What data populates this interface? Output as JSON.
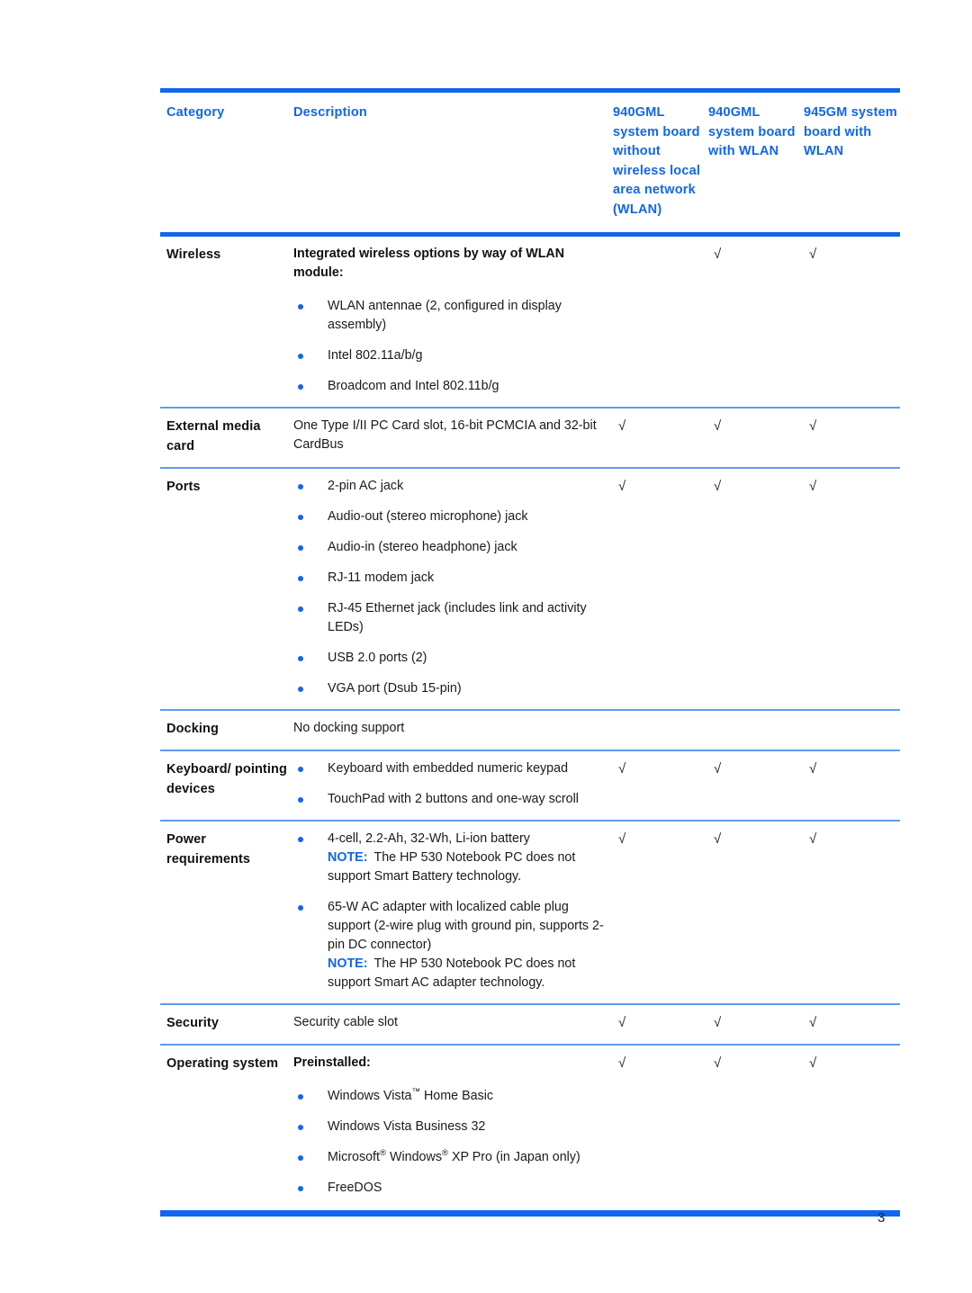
{
  "document": {
    "page_number": "3",
    "accent_color": "#1066EE",
    "rule_color": "#5E9BF0"
  },
  "table": {
    "headers": {
      "category": "Category",
      "description": "Description",
      "col1": "940GML system board without wireless local area network (WLAN)",
      "col2": "940GML system board with WLAN",
      "col3": "945GM system board with WLAN"
    },
    "check_glyph": "√",
    "rows": [
      {
        "category": "Wireless",
        "lead": "Integrated wireless options by way of WLAN module:",
        "bullets": [
          "WLAN antennae (2, configured in display assembly)",
          "Intel 802.11a/b/g",
          "Broadcom and Intel 802.11b/g"
        ],
        "checks": [
          "",
          "√",
          "√"
        ]
      },
      {
        "category": "External media card",
        "text": "One Type I/II PC Card slot, 16-bit PCMCIA and 32-bit CardBus",
        "checks": [
          "√",
          "√",
          "√"
        ]
      },
      {
        "category": "Ports",
        "bullets": [
          "2-pin AC jack",
          "Audio-out (stereo microphone) jack",
          "Audio-in (stereo headphone) jack",
          "RJ-11 modem jack",
          "RJ-45 Ethernet jack (includes link and activity LEDs)",
          "USB 2.0 ports (2)",
          "VGA port (Dsub 15-pin)"
        ],
        "checks": [
          "√",
          "√",
          "√"
        ]
      },
      {
        "category": "Docking",
        "text": "No docking support",
        "checks": [
          "",
          "",
          ""
        ]
      },
      {
        "category": "Keyboard/ pointing devices",
        "bullets": [
          "Keyboard with embedded numeric keypad",
          "TouchPad with 2 buttons and one-way scroll"
        ],
        "checks": [
          "√",
          "√",
          "√"
        ]
      },
      {
        "category": "Power requirements",
        "bullets": [
          "4-cell, 2.2-Ah, 32-Wh, Li-ion battery",
          "65-W AC adapter with localized cable plug support (2-wire plug with ground pin, supports 2-pin DC connector)"
        ],
        "notes": [
          {
            "label": "NOTE:",
            "text": "The HP 530 Notebook PC does not support Smart Battery technology."
          },
          {
            "label": "NOTE:",
            "text": "The HP 530 Notebook PC does not support Smart AC adapter technology."
          }
        ],
        "checks": [
          "√",
          "√",
          "√"
        ]
      },
      {
        "category": "Security",
        "text": "Security cable slot",
        "checks": [
          "√",
          "√",
          "√"
        ]
      },
      {
        "category": "Operating system",
        "lead": "Preinstalled:",
        "bullets": [
          "Windows Vista™ Home Basic",
          "Windows Vista Business 32",
          "Microsoft® Windows® XP Pro (in Japan only)",
          "FreeDOS"
        ],
        "checks": [
          "√",
          "√",
          "√"
        ]
      }
    ]
  }
}
